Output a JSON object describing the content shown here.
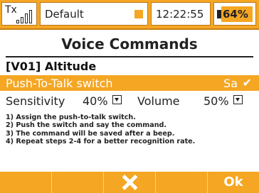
{
  "status_bar": {
    "tx_label": "Tx",
    "model_name": "Default",
    "time": "12:22:55",
    "battery": "64%"
  },
  "title": "Voice Commands",
  "command_label": "[V01]  Altitude",
  "ptt": {
    "label": "Push-To-Talk switch",
    "value": "Sa",
    "check": "✔"
  },
  "sensitivity": {
    "label": "Sensitivity",
    "value": "40%"
  },
  "volume": {
    "label": "Volume",
    "value": "50%"
  },
  "instructions": [
    "1) Assign the push-to-talk switch.",
    "2) Push the switch and say the command.",
    "3) The command will be saved after a beep.",
    "4) Repeat steps 2-4 for a better recognition rate."
  ],
  "bottom_bar": {
    "ok_label": "Ok"
  },
  "colors": {
    "accent": "#f5a623",
    "text": "#222222",
    "background": "#ffffff"
  },
  "icons": {
    "signal": "signal-bars-icon",
    "battery": "battery-icon",
    "cancel": "close-x-icon",
    "check": "checkmark-icon",
    "dropdown": "dropdown-arrow-icon"
  }
}
